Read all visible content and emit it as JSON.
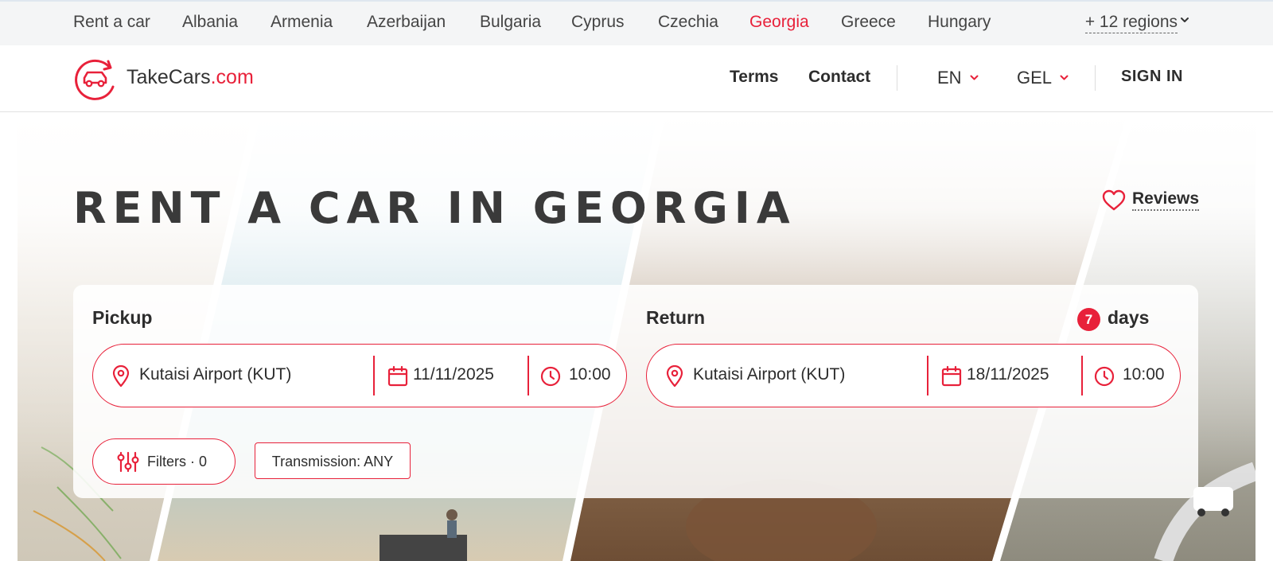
{
  "regions": {
    "items": [
      "Rent a car",
      "Albania",
      "Armenia",
      "Azerbaijan",
      "Bulgaria",
      "Cyprus",
      "Czechia",
      "Georgia",
      "Greece",
      "Hungary"
    ],
    "active": "Georgia",
    "more_label": "+ 12 regions"
  },
  "header": {
    "logo_name": "TakeCars",
    "logo_domain": ".com",
    "nav": {
      "terms": "Terms",
      "contact": "Contact"
    },
    "language": "EN",
    "currency": "GEL",
    "sign_in": "SIGN IN"
  },
  "hero": {
    "title": "RENT A CAR IN GEORGIA",
    "reviews_label": "Reviews"
  },
  "search": {
    "pickup": {
      "label": "Pickup",
      "location": "Kutaisi Airport (KUT)",
      "date": "11/11/2025",
      "time": "10:00"
    },
    "return": {
      "label": "Return",
      "location": "Kutaisi Airport (KUT)",
      "date": "18/11/2025",
      "time": "10:00"
    },
    "duration": {
      "count": "7",
      "unit": "days"
    },
    "filters_label": "Filters · 0",
    "transmission_label": "Transmission: ANY"
  },
  "colors": {
    "accent": "#e8213a",
    "text": "#2d2d2d",
    "topbar_bg": "#f4f5f6"
  },
  "icons": [
    "car-logo-icon",
    "chevron-down-icon",
    "heart-icon",
    "location-pin-icon",
    "calendar-icon",
    "clock-icon",
    "sliders-icon"
  ]
}
